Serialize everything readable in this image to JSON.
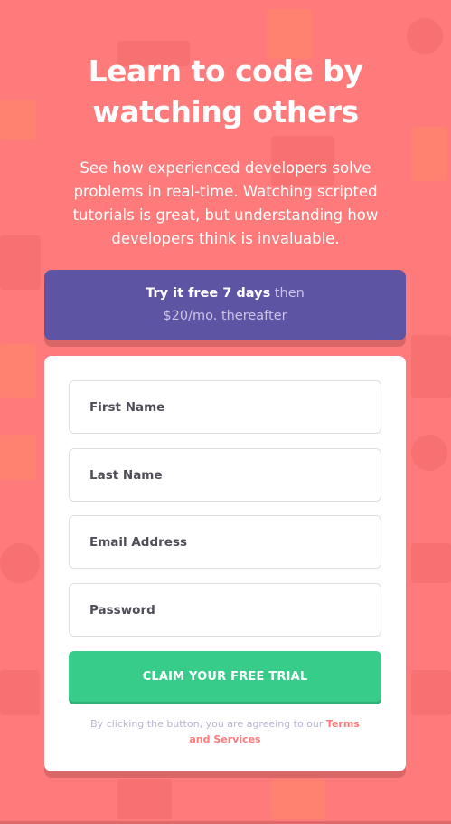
{
  "hero": {
    "title_line1": "Learn to code by",
    "title_line2": "watching others",
    "description": "See how experienced developers solve problems in real-time. Watching scripted tutorials is great, but understanding how developers think is invaluable."
  },
  "trial_banner": {
    "highlight": "Try it free 7 days",
    "rest_line1": " then",
    "rest_line2": "$20/mo. thereafter"
  },
  "form": {
    "first_name_placeholder": "First Name",
    "last_name_placeholder": "Last Name",
    "email_placeholder": "Email Address",
    "password_placeholder": "Password",
    "submit_label": "CLAIM YOUR FREE TRIAL",
    "terms_prefix": "By clicking the button, you are agreeing to our ",
    "terms_link": "Terms and Services"
  },
  "colors": {
    "background": "#ff7a7a",
    "banner": "#5e54a4",
    "button": "#38cc8b",
    "link": "#ff7a7a"
  }
}
